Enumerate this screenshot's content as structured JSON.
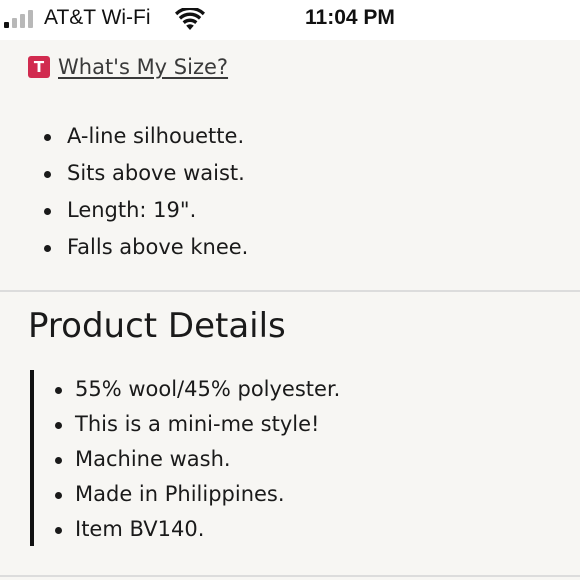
{
  "status_bar": {
    "carrier": "AT&T Wi-Fi",
    "time": "11:04 PM",
    "signal_bars_filled": 1,
    "signal_bars_total": 4
  },
  "size_helper": {
    "badge_letter": "T",
    "link_label": "What's My Size?",
    "badge_color": "#d12b4f"
  },
  "features": [
    "A-line silhouette.",
    "Sits above waist.",
    "Length: 19\".",
    "Falls above knee."
  ],
  "product_details": {
    "title": "Product Details",
    "items": [
      "55% wool/45% polyester.",
      "This is a mini-me style!",
      "Machine wash.",
      "Made in Philippines.",
      "Item BV140."
    ]
  }
}
